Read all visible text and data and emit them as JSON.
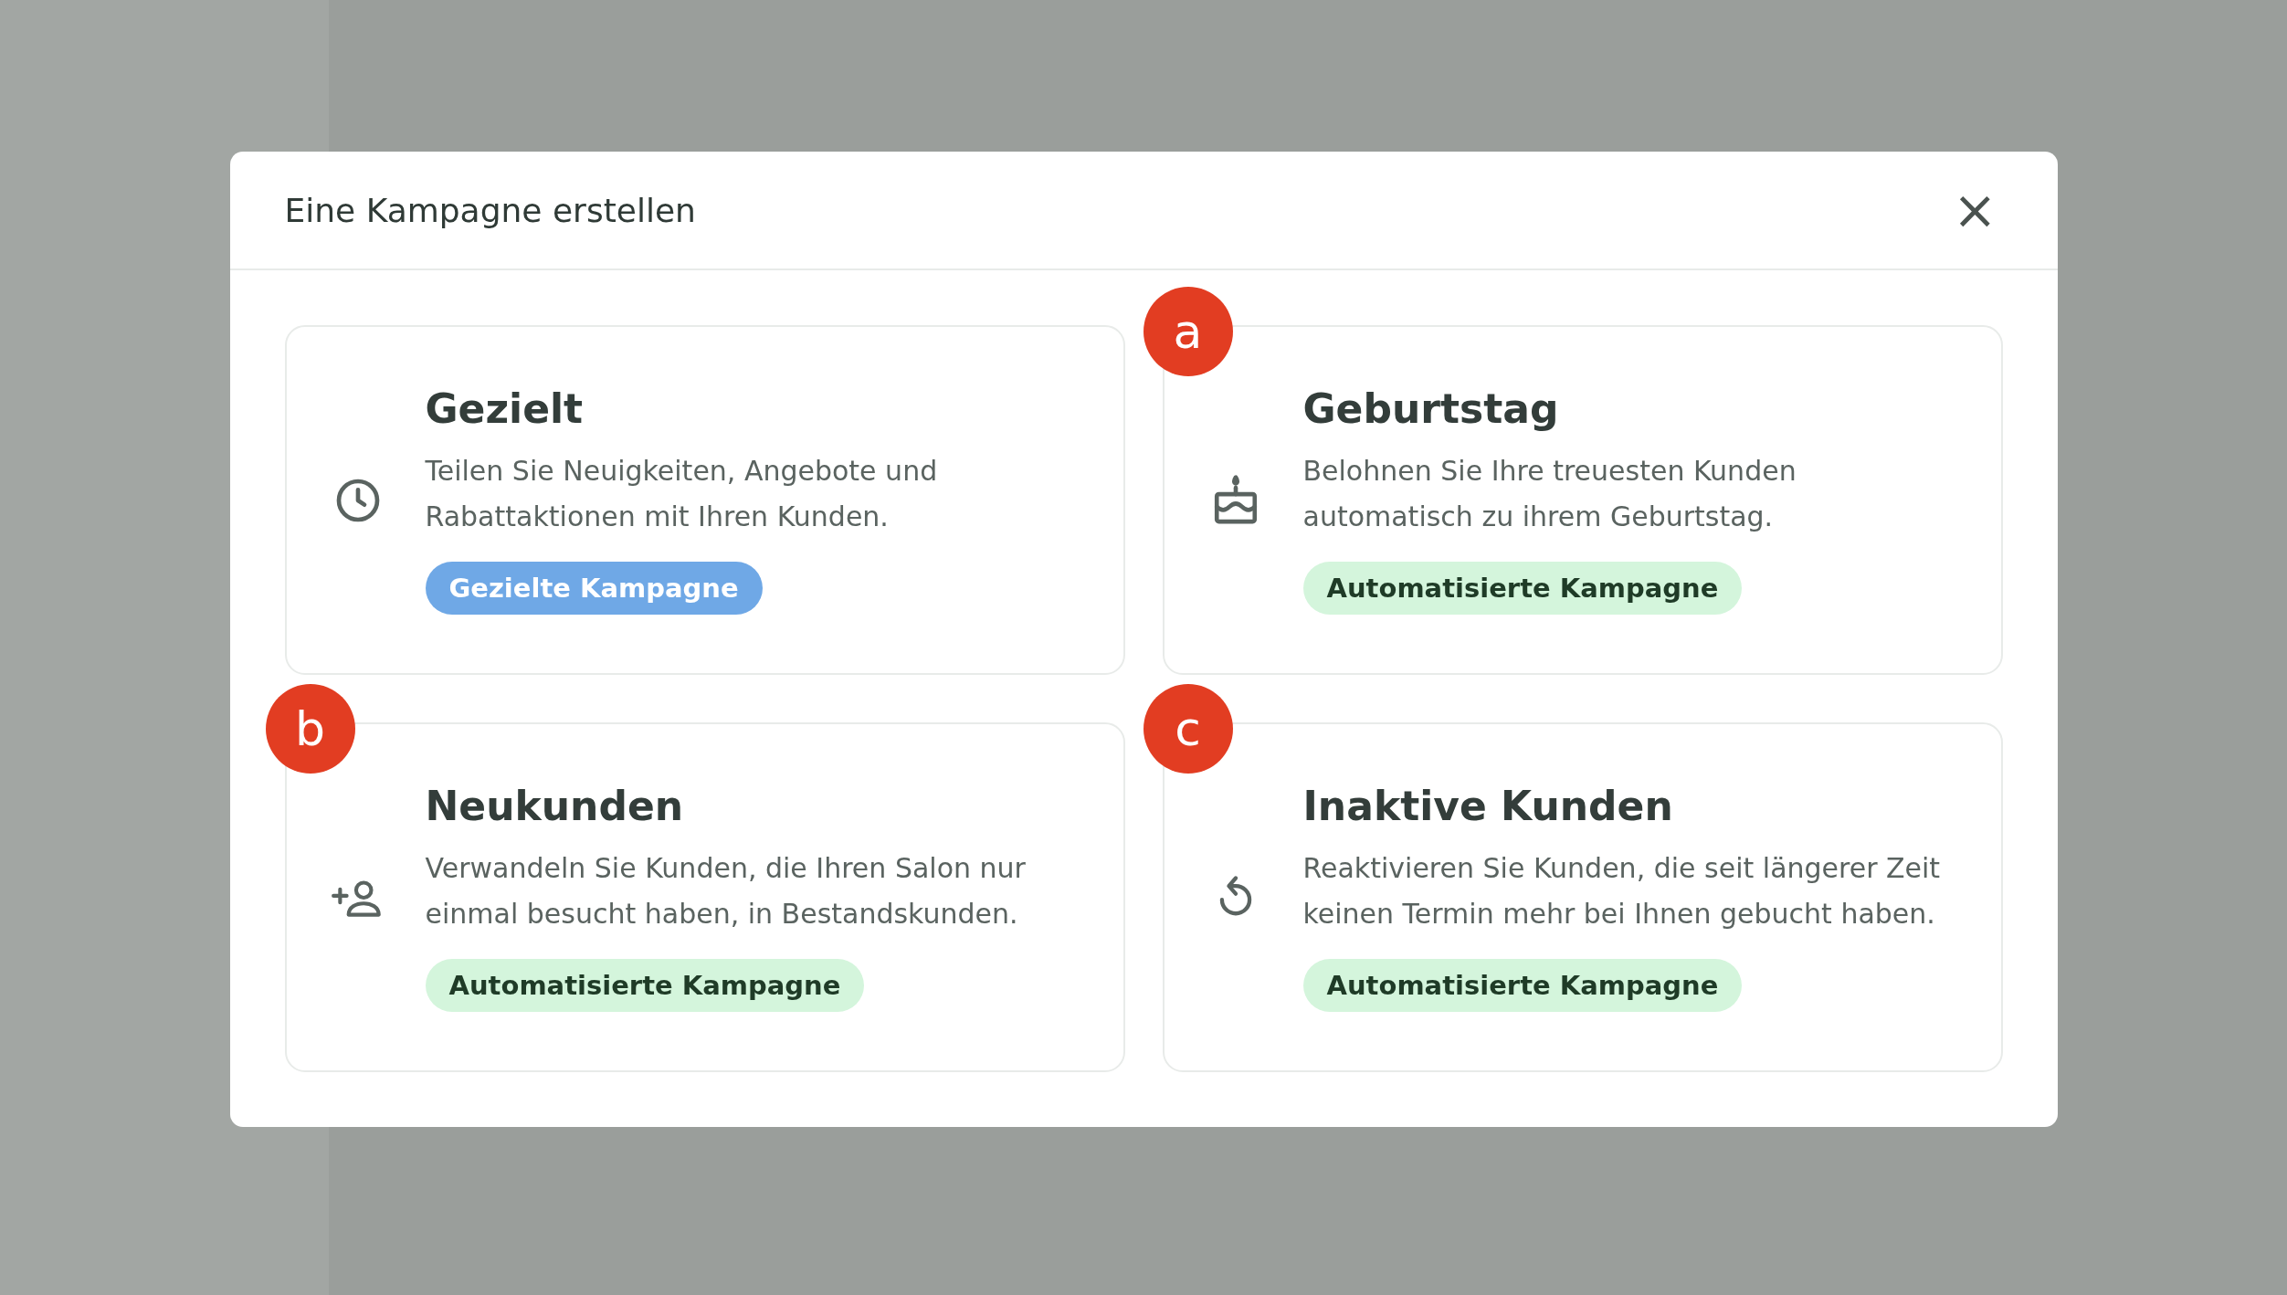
{
  "dialog": {
    "title": "Eine Kampagne erstellen",
    "close_label": "×"
  },
  "cards": [
    {
      "title": "Gezielt",
      "description": "Teilen Sie Neuigkeiten, Angebote und Rabattaktionen mit Ihren Kunden.",
      "badge": {
        "label": "Gezielte Kampagne",
        "kind": "targeted"
      }
    },
    {
      "title": "Geburtstag",
      "description": "Belohnen Sie Ihre treuesten Kunden automatisch zu ihrem Geburtstag.",
      "badge": {
        "label": "Automatisierte Kampagne",
        "kind": "automated"
      },
      "marker": "a"
    },
    {
      "title": "Neukunden",
      "description": "Verwandeln Sie Kunden, die Ihren Salon nur einmal besucht haben, in Bestandskunden.",
      "badge": {
        "label": "Automatisierte Kampagne",
        "kind": "automated"
      },
      "marker": "b"
    },
    {
      "title": "Inaktive Kunden",
      "description": "Reaktivieren Sie Kunden, die seit längerer Zeit keinen Termin mehr bei Ihnen gebucht haben.",
      "badge": {
        "label": "Automatisierte Kampagne",
        "kind": "automated"
      },
      "marker": "c"
    }
  ]
}
